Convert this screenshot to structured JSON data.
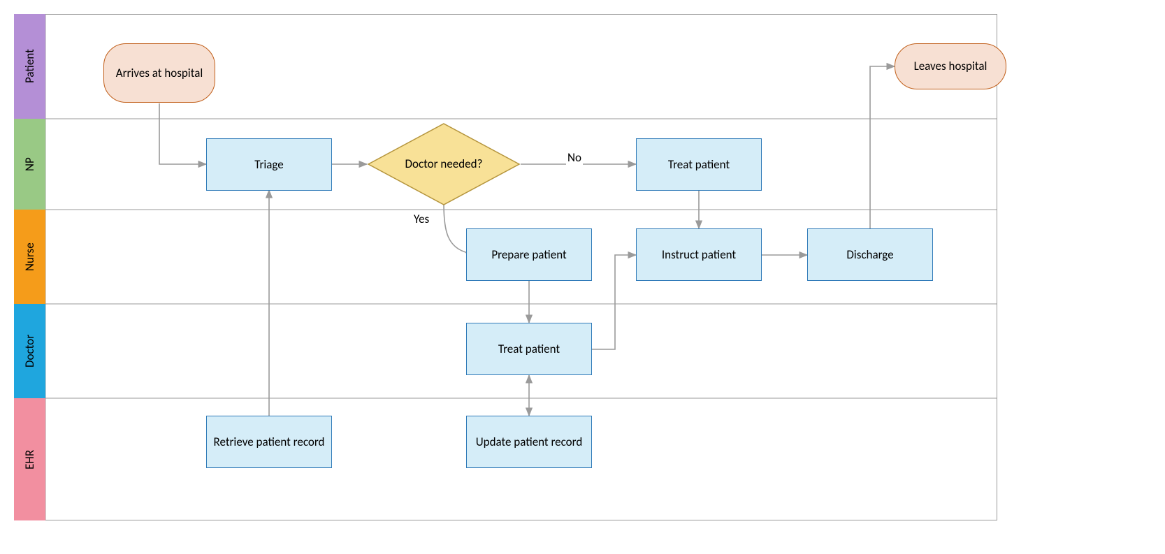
{
  "lanes": {
    "patient": "Patient",
    "np": "NP",
    "nurse": "Nurse",
    "doctor": "Doctor",
    "ehr": "EHR"
  },
  "nodes": {
    "arrives": "Arrives at hospital",
    "leaves": "Leaves hospital",
    "triage": "Triage",
    "decision": "Doctor needed?",
    "treat_np": "Treat patient",
    "prepare": "Prepare patient",
    "instruct": "Instruct patient",
    "discharge": "Discharge",
    "treat_doctor": "Treat patient",
    "retrieve": "Retrieve patient record",
    "update": "Update patient record"
  },
  "edges": {
    "no": "No",
    "yes": "Yes"
  },
  "chart_data": {
    "type": "swimlane-flowchart",
    "lanes": [
      {
        "id": "patient",
        "label": "Patient",
        "color": "#B48FD6"
      },
      {
        "id": "np",
        "label": "NP",
        "color": "#99C985"
      },
      {
        "id": "nurse",
        "label": "Nurse",
        "color": "#F59C1A"
      },
      {
        "id": "doctor",
        "label": "Doctor",
        "color": "#1FA6DE"
      },
      {
        "id": "ehr",
        "label": "EHR",
        "color": "#F28FA0"
      }
    ],
    "nodes": [
      {
        "id": "arrives",
        "lane": "patient",
        "type": "terminator",
        "label": "Arrives at hospital"
      },
      {
        "id": "leaves",
        "lane": "patient",
        "type": "terminator",
        "label": "Leaves hospital"
      },
      {
        "id": "triage",
        "lane": "np",
        "type": "process",
        "label": "Triage"
      },
      {
        "id": "decision",
        "lane": "np",
        "type": "decision",
        "label": "Doctor needed?"
      },
      {
        "id": "treat_np",
        "lane": "np",
        "type": "process",
        "label": "Treat patient"
      },
      {
        "id": "prepare",
        "lane": "nurse",
        "type": "process",
        "label": "Prepare patient"
      },
      {
        "id": "instruct",
        "lane": "nurse",
        "type": "process",
        "label": "Instruct patient"
      },
      {
        "id": "discharge",
        "lane": "nurse",
        "type": "process",
        "label": "Discharge"
      },
      {
        "id": "treat_doctor",
        "lane": "doctor",
        "type": "process",
        "label": "Treat patient"
      },
      {
        "id": "retrieve",
        "lane": "ehr",
        "type": "process",
        "label": "Retrieve patient record"
      },
      {
        "id": "update",
        "lane": "ehr",
        "type": "process",
        "label": "Update patient record"
      }
    ],
    "edges": [
      {
        "from": "arrives",
        "to": "triage"
      },
      {
        "from": "triage",
        "to": "decision"
      },
      {
        "from": "decision",
        "to": "treat_np",
        "label": "No"
      },
      {
        "from": "decision",
        "to": "prepare",
        "label": "Yes"
      },
      {
        "from": "treat_np",
        "to": "instruct"
      },
      {
        "from": "prepare",
        "to": "treat_doctor"
      },
      {
        "from": "treat_doctor",
        "to": "instruct"
      },
      {
        "from": "treat_doctor",
        "to": "update",
        "bidirectional": true
      },
      {
        "from": "retrieve",
        "to": "triage"
      },
      {
        "from": "instruct",
        "to": "discharge"
      },
      {
        "from": "discharge",
        "to": "leaves"
      }
    ]
  }
}
